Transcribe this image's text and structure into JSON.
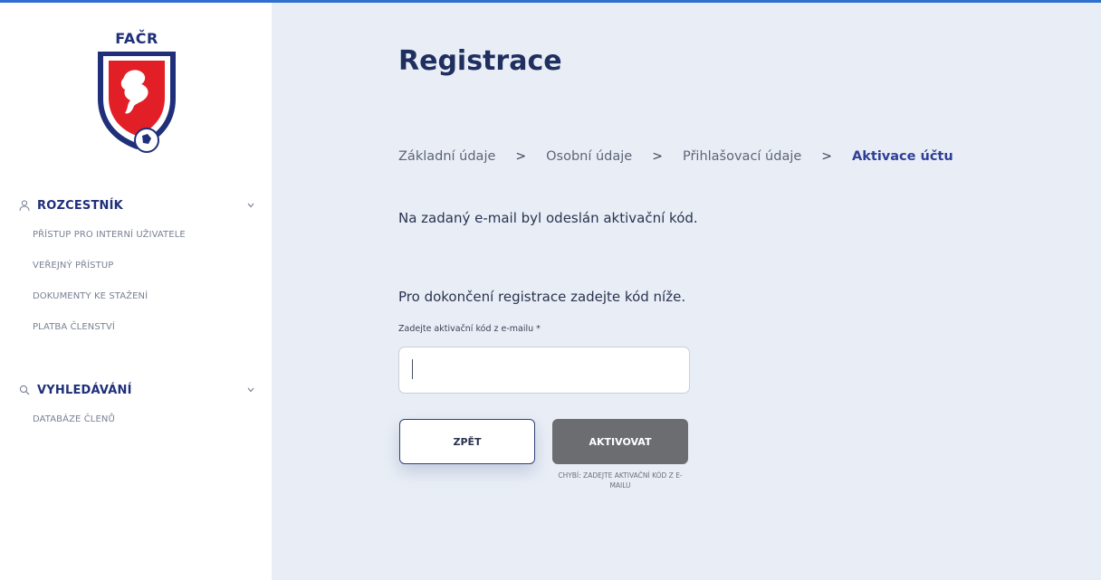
{
  "brand": {
    "logo_text": "FAČR"
  },
  "sidebar": {
    "sections": [
      {
        "title": "ROZCESTNÍK",
        "icon": "user-icon",
        "items": [
          "PŘÍSTUP PRO INTERNÍ UŽIVATELE",
          "VEŘEJNÝ PŘÍSTUP",
          "DOKUMENTY KE STAŽENÍ",
          "PLATBA ČLENSTVÍ"
        ]
      },
      {
        "title": "VYHLEDÁVÁNÍ",
        "icon": "search-icon",
        "items": [
          "DATABÁZE ČLENŮ"
        ]
      }
    ]
  },
  "main": {
    "title": "Registrace",
    "steps": [
      {
        "label": "Základní údaje",
        "active": false
      },
      {
        "label": "Osobní údaje",
        "active": false
      },
      {
        "label": "Přihlašovací údaje",
        "active": false
      },
      {
        "label": "Aktivace účtu",
        "active": true
      }
    ],
    "step_separator": ">",
    "message": "Na zadaný e-mail byl odeslán aktivační kód.",
    "instruction": "Pro dokončení registrace zadejte kód níže.",
    "code_field": {
      "label": "Zadejte aktivační kód z e-mailu *",
      "value": ""
    },
    "back_button": "ZPĚT",
    "activate_button": "AKTIVOVAT",
    "error_message": "CHYBÍ: ZADEJTE AKTIVAČNÍ KÓD Z E-MAILU"
  },
  "colors": {
    "accent": "#2f6fcf",
    "navy": "#1f2f7a",
    "background": "#e9eef6",
    "disabled_button": "#6b6d71"
  }
}
